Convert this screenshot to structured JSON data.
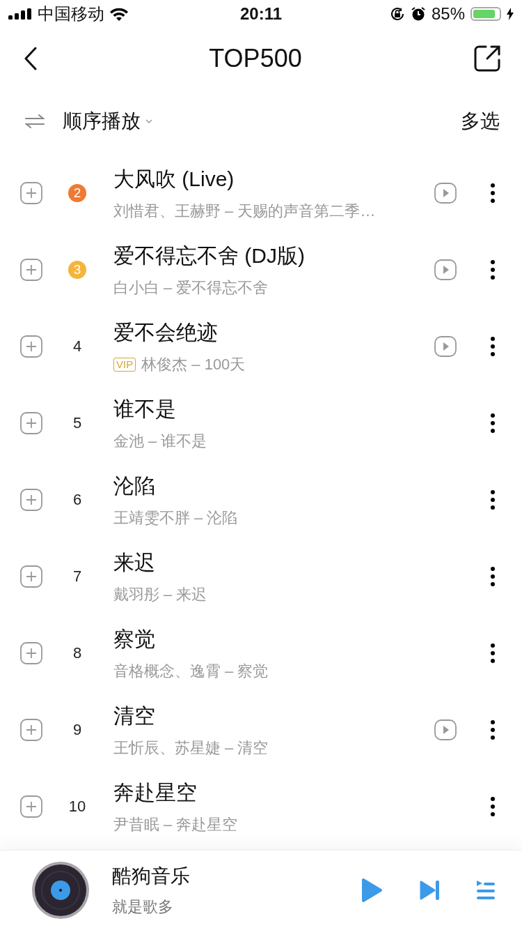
{
  "status_bar": {
    "carrier": "中国移动",
    "time": "20:11",
    "battery": "85%"
  },
  "nav": {
    "title": "TOP500"
  },
  "toolbar": {
    "play_mode": "顺序播放",
    "multi_select": "多选"
  },
  "songs": [
    {
      "rank": "2",
      "kind": "badge",
      "color": "#f07a32",
      "title": "大风吹 (Live)",
      "vip": false,
      "subtitle": "刘惜君、王赫野 – 天赐的声音第二季…",
      "playable": true
    },
    {
      "rank": "3",
      "kind": "badge",
      "color": "#f5b43c",
      "title": "爱不得忘不舍 (DJ版)",
      "vip": false,
      "subtitle": "白小白 – 爱不得忘不舍",
      "playable": true
    },
    {
      "rank": "4",
      "kind": "plain",
      "title": "爱不会绝迹",
      "vip": true,
      "vip_label": "VIP",
      "subtitle": "林俊杰 – 100天",
      "playable": true
    },
    {
      "rank": "5",
      "kind": "plain",
      "title": "谁不是",
      "vip": false,
      "subtitle": "金池 – 谁不是",
      "playable": false
    },
    {
      "rank": "6",
      "kind": "plain",
      "title": "沦陷",
      "vip": false,
      "subtitle": "王靖雯不胖 – 沦陷",
      "playable": false
    },
    {
      "rank": "7",
      "kind": "plain",
      "title": "来迟",
      "vip": false,
      "subtitle": "戴羽彤 – 来迟",
      "playable": false
    },
    {
      "rank": "8",
      "kind": "plain",
      "title": "察觉",
      "vip": false,
      "subtitle": "音格概念、逸霄 – 察觉",
      "playable": false
    },
    {
      "rank": "9",
      "kind": "plain",
      "title": "清空",
      "vip": false,
      "subtitle": "王忻辰、苏星婕 – 清空",
      "playable": true
    },
    {
      "rank": "10",
      "kind": "plain",
      "title": "奔赴星空",
      "vip": false,
      "subtitle": "尹昔眠 – 奔赴星空",
      "playable": false
    }
  ],
  "player": {
    "title": "酷狗音乐",
    "subtitle": "就是歌多"
  }
}
